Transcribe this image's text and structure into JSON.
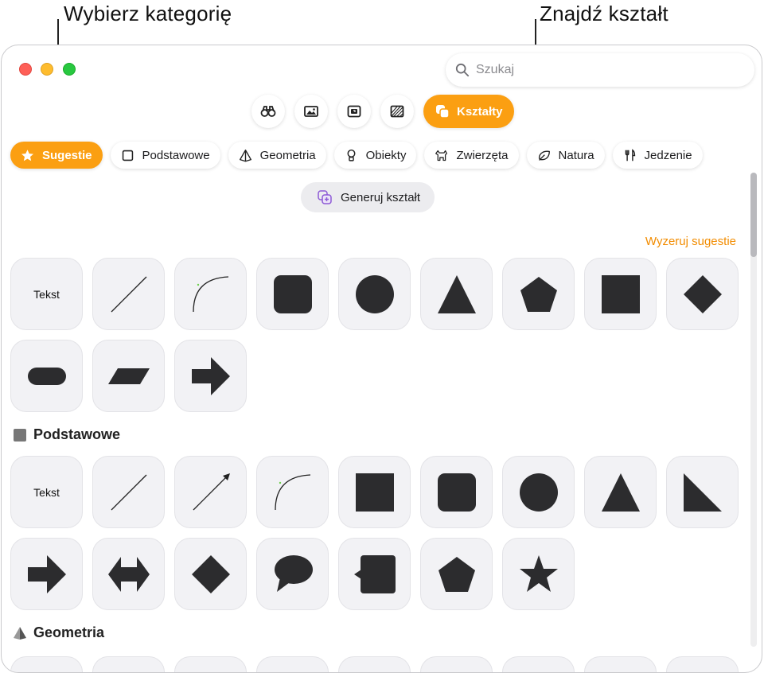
{
  "callouts": {
    "category": "Wybierz kategorię",
    "search": "Znajdź kształt"
  },
  "search": {
    "placeholder": "Szukaj"
  },
  "modes": {
    "active_label": "Kształty",
    "icons": [
      "binoculars-icon",
      "photo-icon",
      "sticker-icon",
      "texture-icon",
      "shapes-icon"
    ]
  },
  "categories": [
    {
      "label": "Sugestie",
      "icon": "star-icon",
      "active": true
    },
    {
      "label": "Podstawowe",
      "icon": "square-icon"
    },
    {
      "label": "Geometria",
      "icon": "pyramid-icon"
    },
    {
      "label": "Obiekty",
      "icon": "lightbulb-icon"
    },
    {
      "label": "Zwierzęta",
      "icon": "dog-icon"
    },
    {
      "label": "Natura",
      "icon": "leaf-icon"
    },
    {
      "label": "Jedzenie",
      "icon": "fork-knife-icon"
    }
  ],
  "generate": {
    "label": "Generuj kształt"
  },
  "reset_label": "Wyzeruj sugestie",
  "suggestions": {
    "text_tile": "Tekst",
    "shapes": [
      "text",
      "line",
      "curve",
      "rounded-square",
      "circle",
      "triangle",
      "pentagon",
      "square",
      "diamond",
      "pill",
      "parallelogram",
      "arrow-right"
    ]
  },
  "sections": {
    "basic": {
      "title": "Podstawowe",
      "text_tile": "Tekst",
      "shapes": [
        "text",
        "line",
        "arrow-line",
        "curve",
        "square",
        "rounded-square",
        "circle",
        "triangle",
        "right-triangle",
        "arrow-right",
        "double-arrow",
        "diamond",
        "speech-bubble",
        "callout-square",
        "pentagon",
        "star"
      ]
    },
    "geometry": {
      "title": "Geometria"
    }
  },
  "colors": {
    "accent": "#fb9f12",
    "shape_fill": "#2c2c2e",
    "reset_link": "#f28c00"
  }
}
